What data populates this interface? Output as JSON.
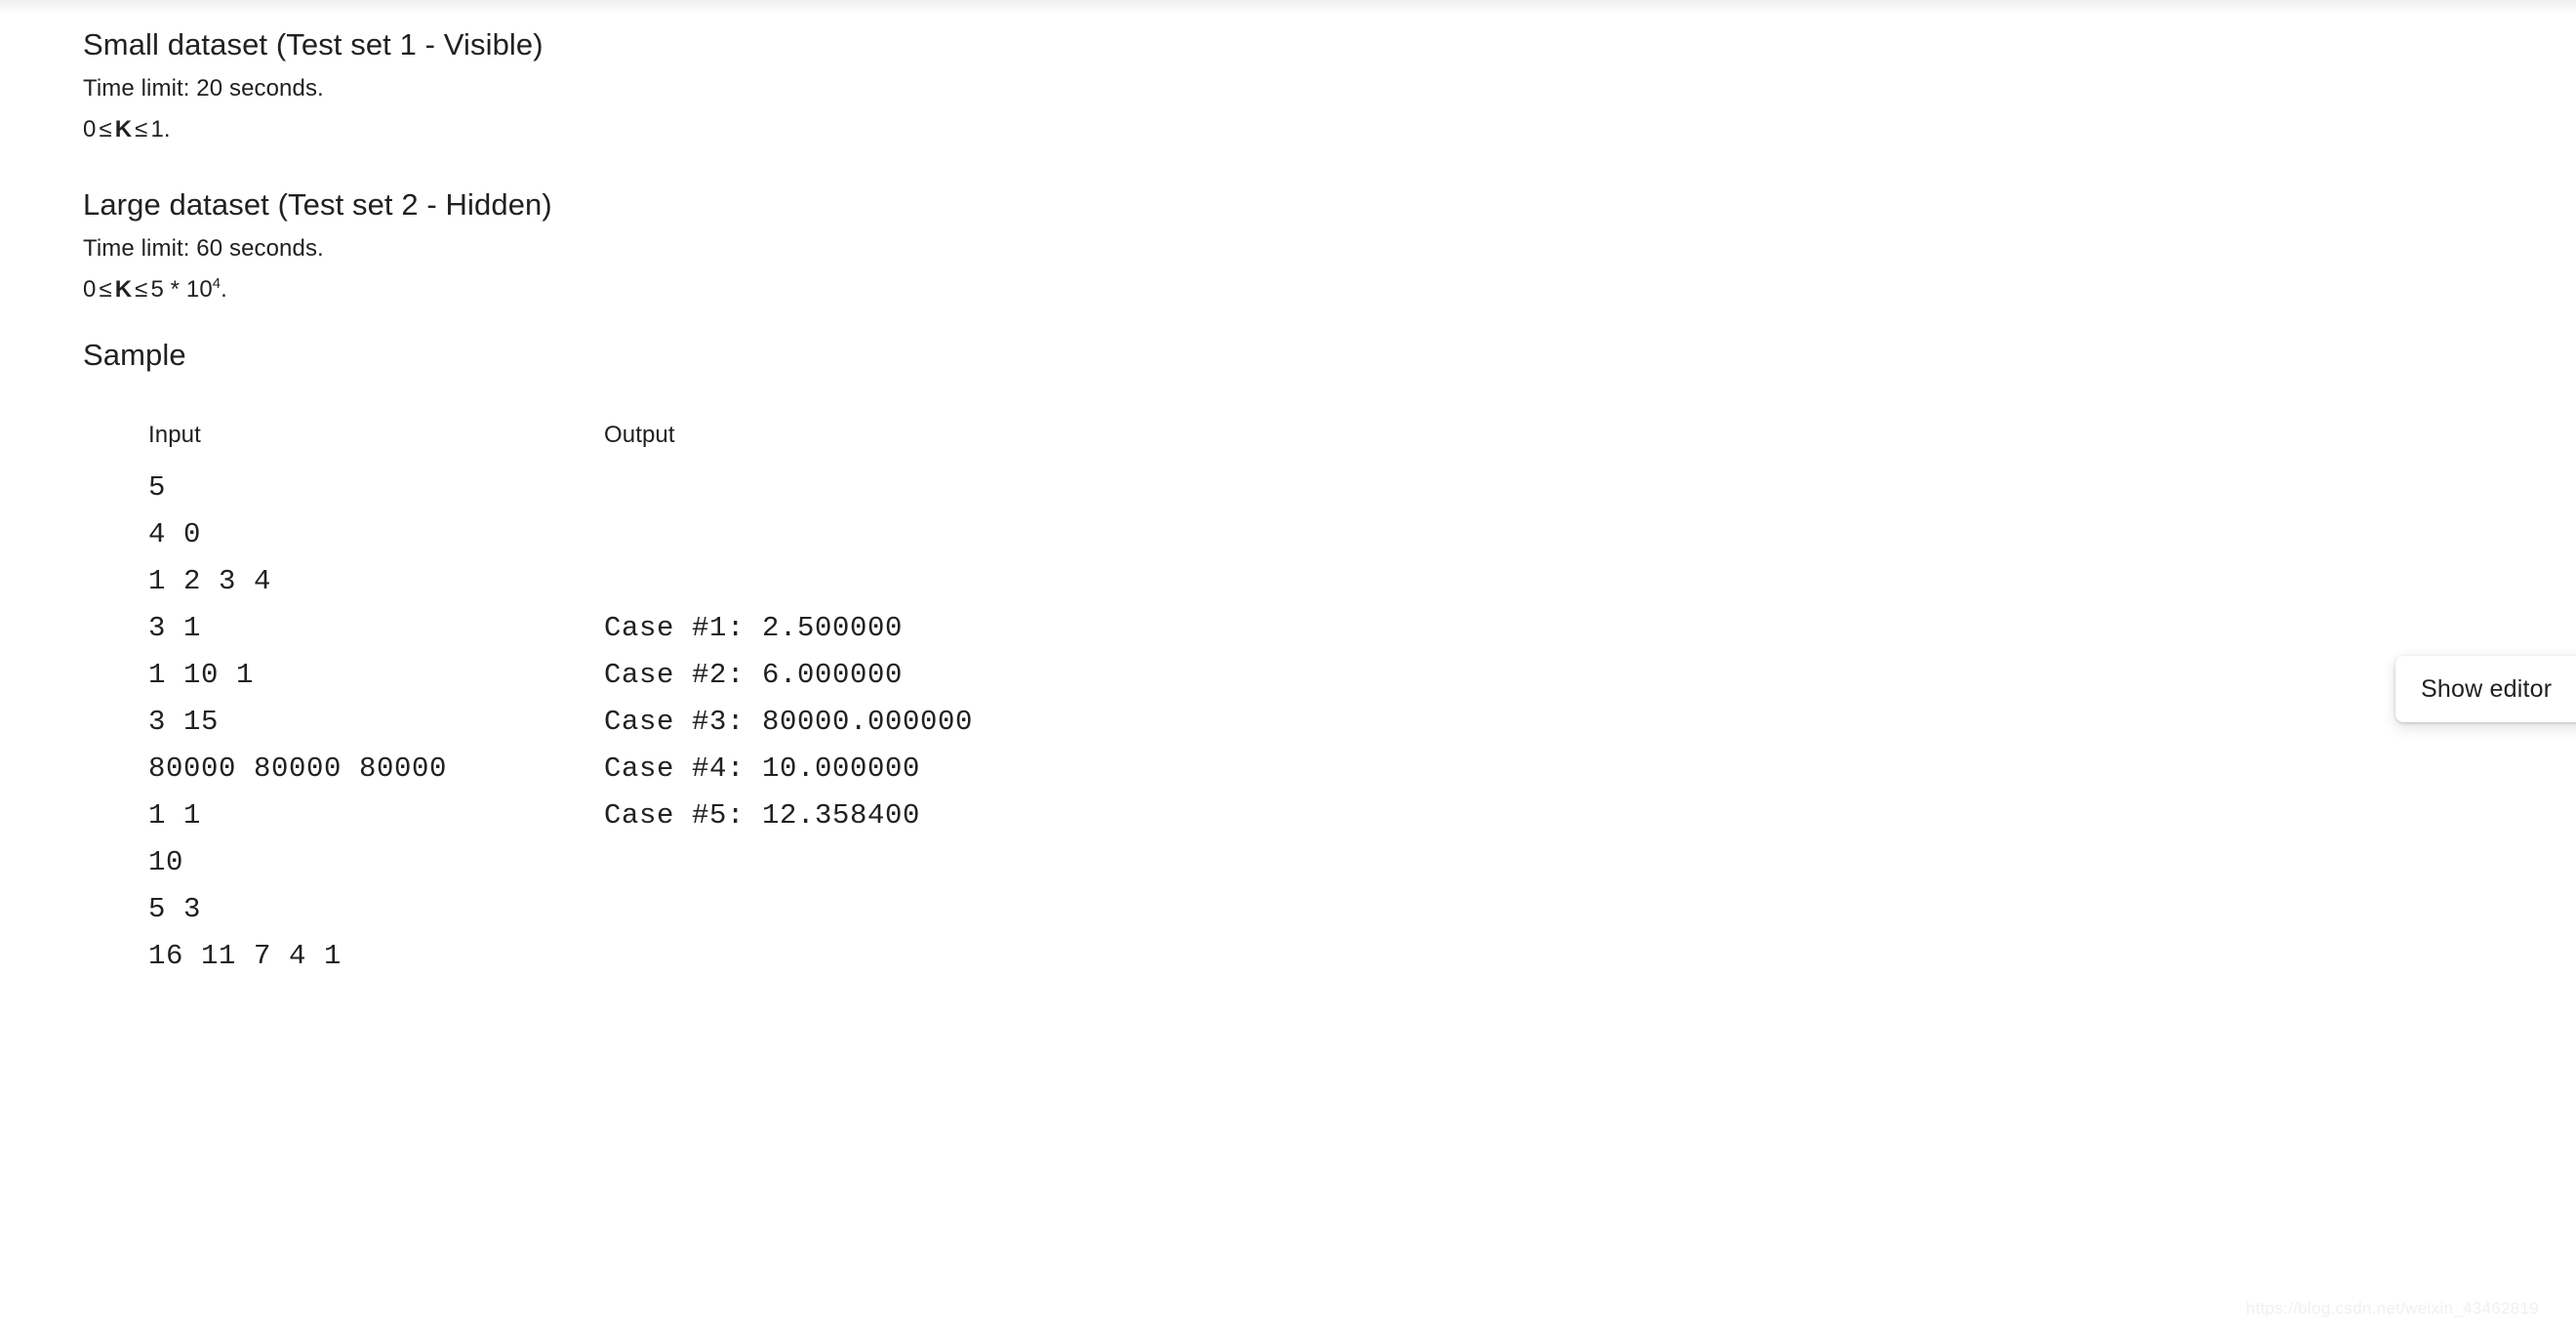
{
  "page": {
    "background_color": "#ffffff",
    "text_color": "#202124"
  },
  "small_dataset": {
    "heading": "Small dataset (Test set 1 - Visible)",
    "time_limit": "Time limit: 20 seconds.",
    "constraint": {
      "lower": "0",
      "op1": "≤",
      "variable": "K",
      "op2": "≤",
      "upper": "1",
      "suffix": "."
    }
  },
  "large_dataset": {
    "heading": "Large dataset (Test set 2 - Hidden)",
    "time_limit": "Time limit: 60 seconds.",
    "constraint": {
      "lower": "0",
      "op1": "≤",
      "variable": "K",
      "op2": "≤",
      "upper_mantissa": "5 * 10",
      "upper_exponent": "4",
      "suffix": "."
    }
  },
  "sample": {
    "heading": "Sample",
    "columns": {
      "input_header": "Input",
      "output_header": "Output"
    },
    "input_lines": [
      "5",
      "4 0",
      "1 2 3 4",
      "3 1",
      "1 10 1",
      "3 15",
      "80000 80000 80000",
      "1 1",
      "10",
      "5 3",
      "16 11 7 4 1"
    ],
    "output_lines": [
      "Case #1: 2.500000",
      "Case #2: 6.000000",
      "Case #3: 80000.000000",
      "Case #4: 10.000000",
      "Case #5: 12.358400"
    ]
  },
  "floating": {
    "show_editor_label": "Show editor"
  },
  "watermark": {
    "text": "https://blog.csdn.net/weixin_43462819"
  }
}
